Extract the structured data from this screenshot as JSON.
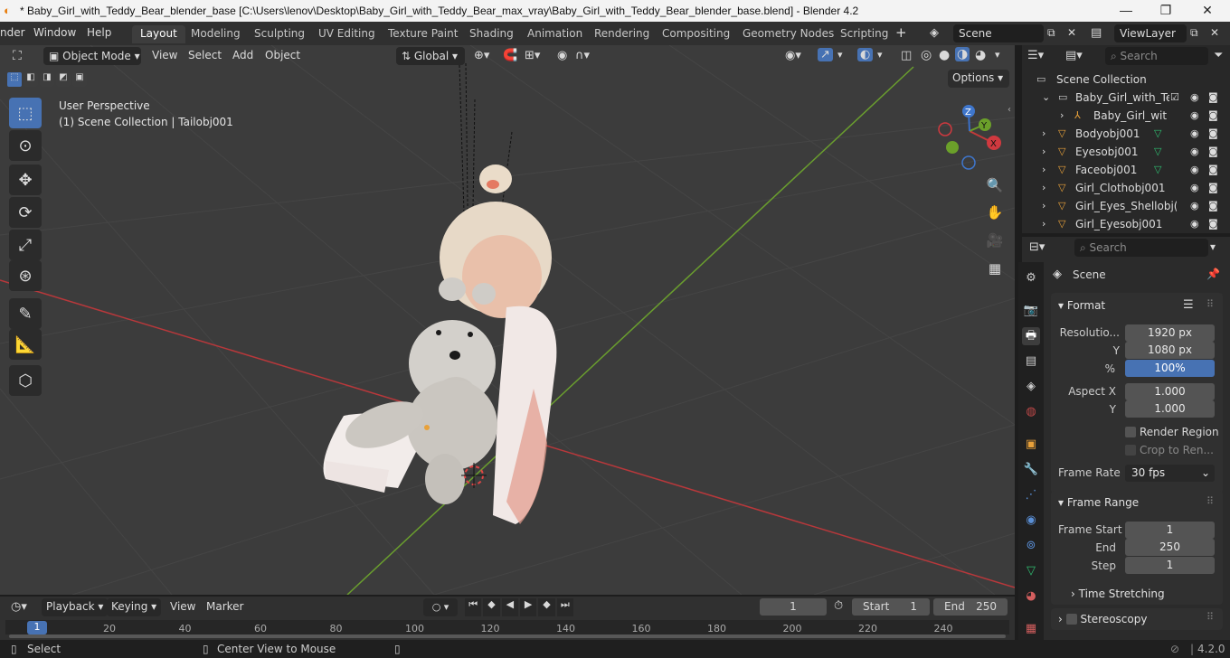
{
  "window": {
    "title": "* Baby_Girl_with_Teddy_Bear_blender_base [C:\\Users\\lenov\\Desktop\\Baby_Girl_with_Teddy_Bear_max_vray\\Baby_Girl_with_Teddy_Bear_blender_base.blend] - Blender 4.2",
    "minimize": "—",
    "maximize": "❐",
    "close": "✕"
  },
  "menus": [
    "nder",
    "Window",
    "Help"
  ],
  "workspaces": [
    "Layout",
    "Modeling",
    "Sculpting",
    "UV Editing",
    "Texture Paint",
    "Shading",
    "Animation",
    "Rendering",
    "Compositing",
    "Geometry Nodes",
    "Scripting"
  ],
  "scene": {
    "name": "Scene",
    "viewlayer": "ViewLayer"
  },
  "viewport": {
    "mode": "Object Mode",
    "menus": [
      "View",
      "Select",
      "Add",
      "Object"
    ],
    "orientation": "Global",
    "options": "Options",
    "perspective": "User Perspective",
    "collection_info": "(1) Scene Collection | Tailobj001"
  },
  "outliner": {
    "search_placeholder": "Search",
    "root": "Scene Collection",
    "items": [
      {
        "label": "Baby_Girl_with_Tec",
        "indent": 0
      },
      {
        "label": "Baby_Girl_with_",
        "indent": 1
      },
      {
        "label": "Bodyobj001",
        "indent": 0
      },
      {
        "label": "Eyesobj001",
        "indent": 0
      },
      {
        "label": "Faceobj001",
        "indent": 0
      },
      {
        "label": "Girl_Clothobj001",
        "indent": 0
      },
      {
        "label": "Girl_Eyes_Shellobj(",
        "indent": 0
      },
      {
        "label": "Girl_Eyesobj001",
        "indent": 0
      }
    ]
  },
  "properties": {
    "search_placeholder": "Search",
    "context": "Scene",
    "format": {
      "header": "Format",
      "resolution_label": "Resolutio...",
      "res_x": "1920 px",
      "y_label": "Y",
      "res_y": "1080 px",
      "pct_label": "%",
      "pct": "100%",
      "aspect_x_label": "Aspect X",
      "aspect_x": "1.000",
      "aspect_y_label": "Y",
      "aspect_y": "1.000",
      "render_region": "Render Region",
      "crop": "Crop to Ren...",
      "frame_rate_label": "Frame Rate",
      "frame_rate": "30 fps"
    },
    "frame_range": {
      "header": "Frame Range",
      "start_label": "Frame Start",
      "start": "1",
      "end_label": "End",
      "end": "250",
      "step_label": "Step",
      "step": "1",
      "time_stretching": "Time Stretching"
    },
    "stereoscopy": "Stereoscopy"
  },
  "timeline": {
    "menus": [
      "Playback",
      "Keying",
      "View",
      "Marker"
    ],
    "current_frame": "1",
    "start_label": "Start",
    "start": "1",
    "end_label": "End",
    "end": "250",
    "ticks": [
      "1",
      "20",
      "40",
      "60",
      "80",
      "100",
      "120",
      "140",
      "160",
      "180",
      "200",
      "220",
      "240"
    ]
  },
  "status": {
    "select": "Select",
    "center": "Center View to Mouse",
    "version": "4.2.0"
  },
  "colors": {
    "accent": "#4772b3",
    "x_axis": "#c23a3a",
    "y_axis": "#6ba02a"
  }
}
